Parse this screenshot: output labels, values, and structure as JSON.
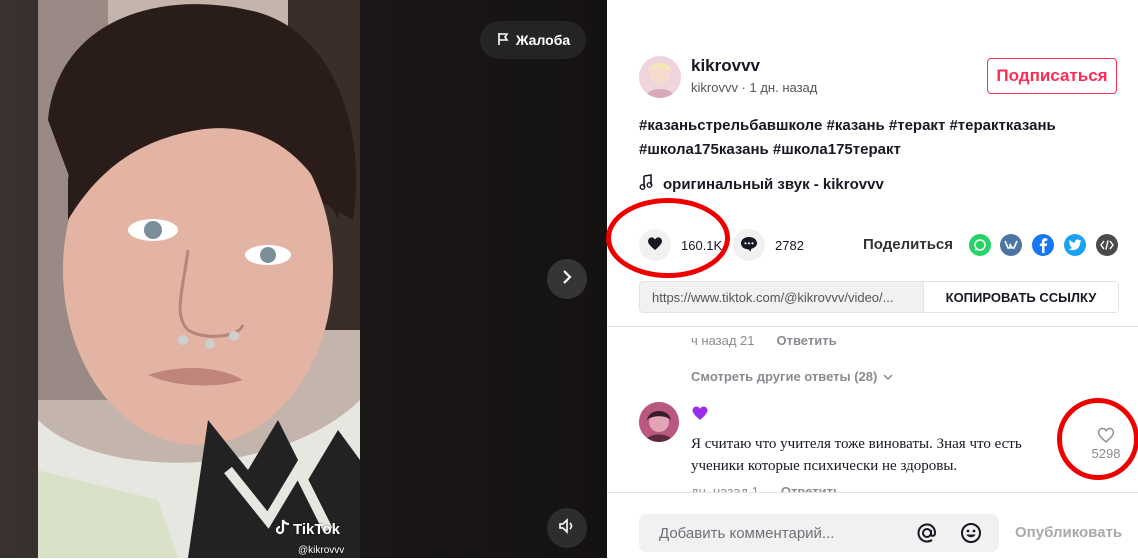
{
  "video": {
    "report_label": "Жалоба",
    "watermark": "TikTok",
    "watermark_handle": "@kikrovvv"
  },
  "post": {
    "author_name": "kikrovvv",
    "author_sub": "kikrovvv · 1 дн. назад",
    "follow_label": "Подписаться",
    "description_line1": "#казаньстрельбавшколе #казань #теракт #терактказань",
    "description_line2": "#школа175казань #школа175теракт",
    "sound": "оригинальный звук - kikrovvv",
    "likes": "160.1K",
    "comments": "2782",
    "share_label": "Поделиться",
    "share_icons": [
      "whatsapp-icon",
      "vk-icon",
      "facebook-icon",
      "twitter-icon",
      "embed-icon"
    ],
    "link_url": "https://www.tiktok.com/@kikrovvv/video/...",
    "copy_label": "КОПИРОВАТЬ ССЫЛКУ"
  },
  "comments": {
    "prev_meta_time": "ч назад 21",
    "reply_label": "Ответить",
    "more_replies": "Смотреть другие ответы (28)",
    "item": {
      "emoji": "purple-heart",
      "text": "Я считаю что учителя тоже виноваты. Зная что есть ученики которые психически не здоровы.",
      "likes": "5298",
      "meta_time": "дн. назад 1"
    }
  },
  "composer": {
    "placeholder": "Добавить комментарий...",
    "post_label": "Опубликовать"
  },
  "colors": {
    "accent": "#fe2c55",
    "annotation": "#e00000",
    "whatsapp": "#25d366",
    "vk": "#4c75a3",
    "facebook": "#1877f2",
    "twitter": "#1da1f2",
    "embed": "#4a4a4a"
  }
}
